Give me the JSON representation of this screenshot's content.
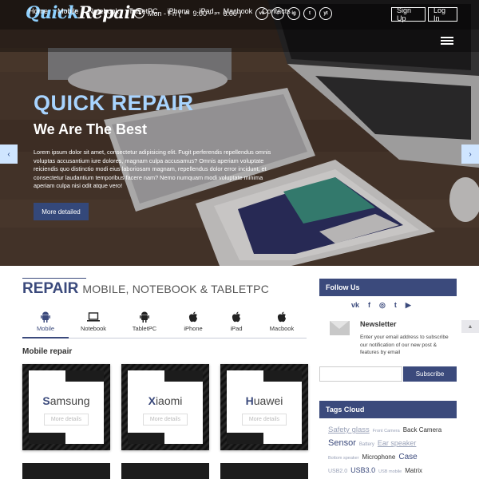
{
  "header": {
    "logo_first": "Quick",
    "logo_second": "Repair",
    "hours_days": "Mon - Fri (",
    "hours_am_label": "am",
    "hours_open": "9:00 -",
    "hours_pm_label": "pm",
    "hours_close": "6:00 )",
    "socials": [
      "vk-icon",
      "facebook-icon",
      "instagram-icon",
      "twitter-icon",
      "youtube-icon"
    ],
    "social_glyphs": [
      "vk",
      "f",
      "ig",
      "t",
      "yt"
    ],
    "signup_label": "Sign Up",
    "login_label": "Log In"
  },
  "nav": {
    "items": [
      "Home",
      "Mobile",
      "Notebook",
      "TabletPC",
      "iPhone",
      "iPad",
      "Macbook",
      "Contacts"
    ]
  },
  "hero": {
    "title": "QUICK REPAIR",
    "subtitle": "We Are The Best",
    "text": "Lorem ipsum dolor sit amet, consectetur adipisicing elit. Fugit perferendis repellendus omnis voluptas accusantium iure dolores, magnam culpa accusamus? Omnis aperiam voluptate reiciendis quo distinctio modi eius laboriosam magnam, repellendus dolor error incidunt, et consectetur laudantium temporibus facere nam? Nemo numquam modi voluptate minima aperiam culpa nisi odit atque vero!",
    "button_label": "More detailed",
    "prev_glyph": "‹",
    "next_glyph": "›"
  },
  "main": {
    "heading_strong": "REPAIR",
    "heading_rest": "MOBILE, NOTEBOOK & TABLETPC",
    "tabs": [
      {
        "label": "Mobile",
        "icon": "android-icon"
      },
      {
        "label": "Notebook",
        "icon": "laptop-icon"
      },
      {
        "label": "TabletPC",
        "icon": "android-icon"
      },
      {
        "label": "iPhone",
        "icon": "apple-icon"
      },
      {
        "label": "iPad",
        "icon": "apple-icon"
      },
      {
        "label": "Macbook",
        "icon": "apple-icon"
      }
    ],
    "active_tab": "Mobile",
    "subheading": "Mobile repair",
    "cards": [
      {
        "initial": "S",
        "rest": "amsung",
        "more": "More details"
      },
      {
        "initial": "X",
        "rest": "iaomi",
        "more": "More details"
      },
      {
        "initial": "H",
        "rest": "uawei",
        "more": "More details"
      }
    ]
  },
  "sidebar": {
    "follow_title": "Follow Us",
    "follow_icons": [
      "vk-icon",
      "facebook-icon",
      "instagram-icon",
      "twitter-icon",
      "youtube-icon"
    ],
    "follow_glyphs": [
      "vk",
      "f",
      "◎",
      "t",
      "▶"
    ],
    "newsletter_title": "Newsletter",
    "newsletter_text": "Enter your email address to subscribe our notification of our new post & features by email",
    "email_placeholder": "",
    "subscribe_label": "Subscribe",
    "tags_title": "Tags Cloud",
    "tags": [
      {
        "text": "Safety glass",
        "style": "light-underline"
      },
      {
        "text": "Front Camera",
        "style": "tiny"
      },
      {
        "text": "Back Camera",
        "style": "normal"
      },
      {
        "text": "Sensor",
        "style": "big-blue"
      },
      {
        "text": "Battery",
        "style": "tiny"
      },
      {
        "text": "Ear speaker",
        "style": "light-underline"
      },
      {
        "text": "Bottom speaker",
        "style": "tiny"
      },
      {
        "text": "Microphone",
        "style": "normal"
      },
      {
        "text": "Case",
        "style": "big-blue"
      },
      {
        "text": "USB2.0",
        "style": "small"
      },
      {
        "text": "USB3.0",
        "style": "mid-blue"
      },
      {
        "text": "USB mobile",
        "style": "tiny"
      },
      {
        "text": "Matrix",
        "style": "normal"
      }
    ],
    "back_to_top_glyph": "▲"
  }
}
